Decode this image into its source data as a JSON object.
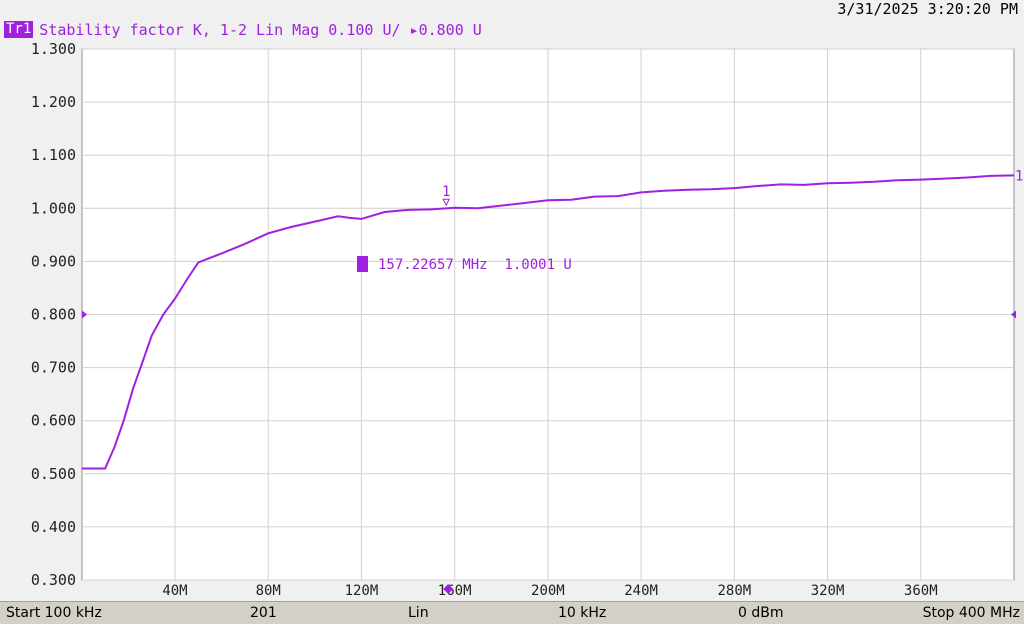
{
  "timestamp": "3/31/2025  3:20:20 PM",
  "trace": {
    "badge": "Tr1",
    "label": "Stability factor K, 1-2 Lin Mag 0.100 U/ ▸0.800 U"
  },
  "status_bar": {
    "start": "Start 100 kHz",
    "points": "201",
    "sweep_type": "Lin",
    "ifbw": "10 kHz",
    "power": "0 dBm",
    "stop": "Stop 400 MHz"
  },
  "colors": {
    "trace": "#a020e0",
    "grid": "#d0d0d0",
    "plot_bg": "#ffffff"
  },
  "chart_data": {
    "type": "line",
    "title": "Stability factor K",
    "xlabel": "",
    "ylabel": "",
    "xlim": [
      0.1,
      400
    ],
    "ylim": [
      0.3,
      1.3
    ],
    "grid": true,
    "y_ticks": [
      "1.300",
      "1.200",
      "1.100",
      "1.000",
      "0.900",
      "0.800",
      "0.700",
      "0.600",
      "0.500",
      "0.400",
      "0.300"
    ],
    "y_tick_values": [
      1.3,
      1.2,
      1.1,
      1.0,
      0.9,
      0.8,
      0.7,
      0.6,
      0.5,
      0.4,
      0.3
    ],
    "reference_value": 0.8,
    "x_ticks": [
      "40M",
      "80M",
      "120M",
      "160M",
      "200M",
      "240M",
      "280M",
      "320M",
      "360M"
    ],
    "x_tick_values": [
      40,
      80,
      120,
      160,
      200,
      240,
      280,
      320,
      360
    ],
    "series": [
      {
        "x": [
          0.1,
          10,
          14,
          18,
          22,
          26,
          30,
          35,
          40,
          45,
          50,
          60,
          70,
          80,
          90,
          100,
          110,
          115,
          120,
          130,
          140,
          150,
          157,
          160,
          170,
          180,
          190,
          200,
          210,
          220,
          230,
          240,
          250,
          260,
          270,
          280,
          290,
          300,
          310,
          320,
          330,
          340,
          350,
          360,
          370,
          380,
          390,
          400
        ],
        "values": [
          0.51,
          0.51,
          0.55,
          0.6,
          0.66,
          0.71,
          0.76,
          0.8,
          0.83,
          0.865,
          0.898,
          0.915,
          0.933,
          0.953,
          0.965,
          0.975,
          0.985,
          0.982,
          0.98,
          0.993,
          0.997,
          0.998,
          1.0001,
          1.001,
          1.0,
          1.005,
          1.01,
          1.015,
          1.016,
          1.022,
          1.023,
          1.03,
          1.033,
          1.035,
          1.036,
          1.038,
          1.042,
          1.045,
          1.044,
          1.047,
          1.048,
          1.05,
          1.053,
          1.054,
          1.056,
          1.058,
          1.061,
          1.062
        ]
      }
    ],
    "marker": {
      "id": "1",
      "x": 157.22657,
      "y": 1.0001,
      "readout": "157.22657 MHz  1.0001 U"
    }
  }
}
